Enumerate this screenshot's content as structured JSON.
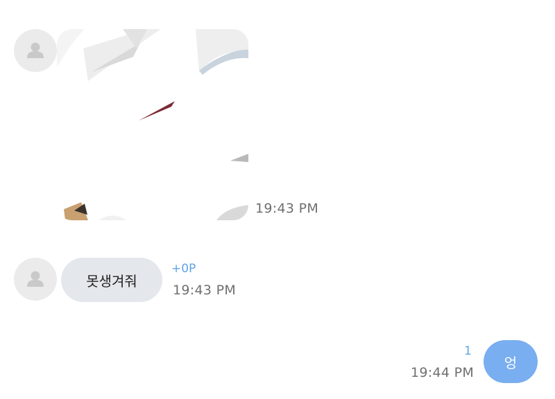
{
  "messages": [
    {
      "type": "image",
      "sender": "other",
      "time": "19:43 PM",
      "avatar_icon": "user-placeholder-icon"
    },
    {
      "type": "text",
      "sender": "other",
      "text": "못생겨줘",
      "reaction": "+0P",
      "time": "19:43 PM",
      "avatar_icon": "user-placeholder-icon"
    },
    {
      "type": "text",
      "sender": "me",
      "text": "엉",
      "read_count": "1",
      "time": "19:44 PM"
    }
  ],
  "colors": {
    "background": "#ffffff",
    "incoming_bubble": "#e4e7ec",
    "outgoing_bubble": "#79aef0",
    "outgoing_text": "#ffffff",
    "timestamp": "#6f6f6f",
    "accent": "#5ea4e6",
    "avatar_bg": "#ebebeb",
    "avatar_icon": "#c9c9c9"
  }
}
